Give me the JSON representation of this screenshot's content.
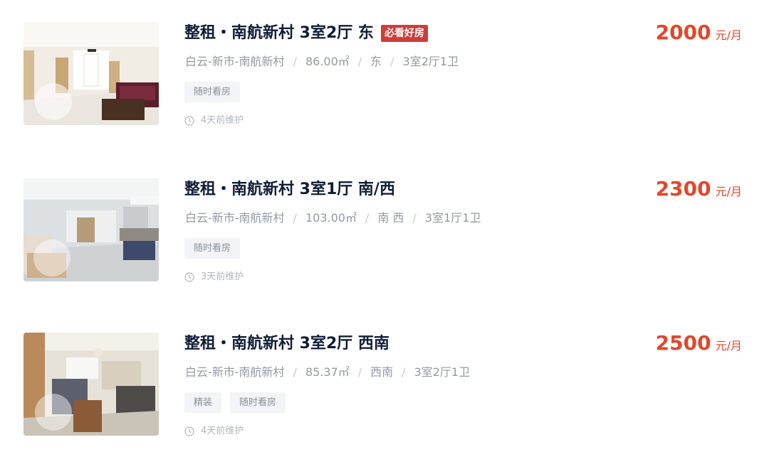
{
  "listings": [
    {
      "title": "整租・南航新村 3室2厅 东",
      "badge": "必看好房",
      "district": "白云-新市-南航新村",
      "area": "86.00㎡",
      "orientation": "东",
      "layout": "3室2厅1卫",
      "tags": [
        "随时看房"
      ],
      "maintained": "4天前维护",
      "price": "2000",
      "price_unit": "元/月"
    },
    {
      "title": "整租・南航新村 3室1厅 南/西",
      "district": "白云-新市-南航新村",
      "area": "103.00㎡",
      "orientation": "南 西",
      "layout": "3室1厅1卫",
      "tags": [
        "随时看房"
      ],
      "maintained": "3天前维护",
      "price": "2300",
      "price_unit": "元/月"
    },
    {
      "title": "整租・南航新村 3室2厅 西南",
      "district": "白云-新市-南航新村",
      "area": "85.37㎡",
      "orientation": "西南",
      "layout": "3室2厅1卫",
      "tags": [
        "精装",
        "随时看房"
      ],
      "maintained": "4天前维护",
      "price": "2500",
      "price_unit": "元/月"
    }
  ],
  "colors": {
    "title": "#101d37",
    "price": "#e4462b",
    "badge": "#d03c3a",
    "meta": "#9399a5",
    "tag_bg": "#f2f4f7"
  },
  "icons": {
    "maintained": "clock-icon",
    "thumbnail_overlay": "vr-360-icon"
  }
}
